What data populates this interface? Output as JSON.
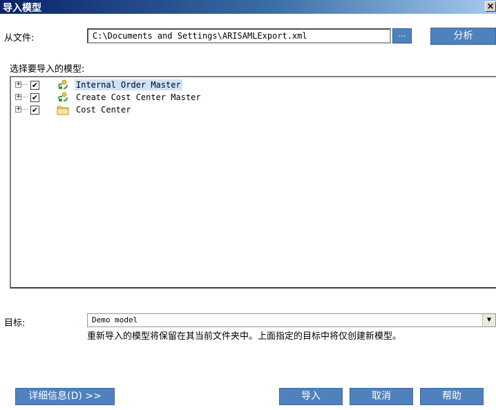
{
  "window": {
    "title": "导入模型",
    "close_glyph": "×"
  },
  "file": {
    "label": "从文件:",
    "path": "C:\\Documents and Settings\\ARISAMLExport.xml",
    "browse_label": "...",
    "analyze_label": "分析"
  },
  "models": {
    "label": "选择要导入的模型:",
    "items": [
      {
        "label": "Internal Order Master",
        "checked": true,
        "icon": "process-model-icon"
      },
      {
        "label": "Create Cost Center Master",
        "checked": true,
        "icon": "process-model-icon"
      },
      {
        "label": "Cost Center",
        "checked": true,
        "icon": "folder-icon"
      }
    ]
  },
  "target": {
    "label": "目标:",
    "value": "Demo model",
    "note": "重新导入的模型将保留在其当前文件夹中。上面指定的目标中将仅创建新模型。"
  },
  "buttons": {
    "details": "详细信息(D) >>",
    "import": "导入",
    "cancel": "取消",
    "help": "帮助"
  },
  "colors": {
    "button_blue": "#4f81bd",
    "title_dark": "#0a246a",
    "selection": "#cfe2f7"
  }
}
